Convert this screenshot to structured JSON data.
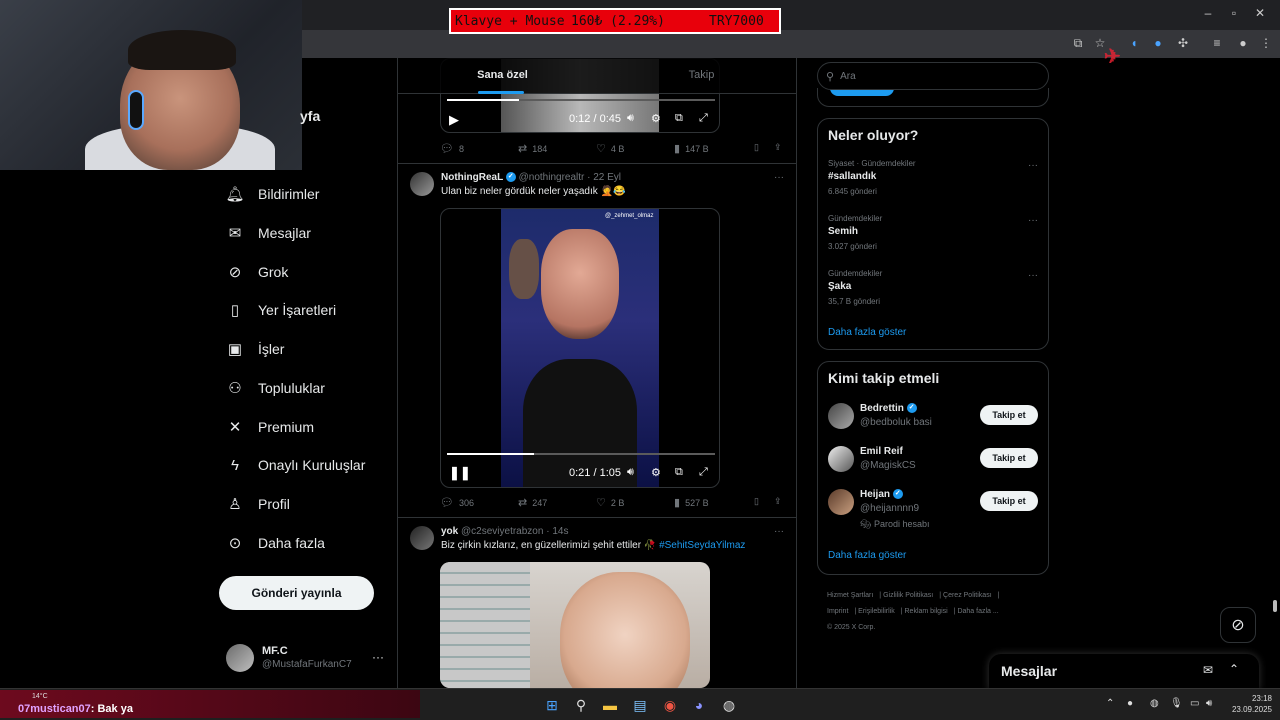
{
  "ticker": {
    "label": "Klavye + Mouse",
    "amount": "160₺ (2.29%)",
    "goal": "TRY7000"
  },
  "nav": {
    "home_fragment": "yfa",
    "items": [
      {
        "label": "Bildirimler",
        "icon": "bell-icon"
      },
      {
        "label": "Mesajlar",
        "icon": "envelope-icon"
      },
      {
        "label": "Grok",
        "icon": "grok-icon"
      },
      {
        "label": "Yer İşaretleri",
        "icon": "bookmark-icon"
      },
      {
        "label": "İşler",
        "icon": "briefcase-icon"
      },
      {
        "label": "Topluluklar",
        "icon": "people-icon"
      },
      {
        "label": "Premium",
        "icon": "x-logo-icon"
      },
      {
        "label": "Onaylı Kuruluşlar",
        "icon": "lightning-icon"
      },
      {
        "label": "Profil",
        "icon": "person-icon"
      },
      {
        "label": "Daha fazla",
        "icon": "more-circle-icon"
      }
    ],
    "post_button": "Gönderi yayınla",
    "account": {
      "name": "MF.C",
      "handle": "@MustafaFurkanC7"
    }
  },
  "timeline": {
    "tabs": [
      "Sana özel",
      "Takip"
    ],
    "video1": {
      "time": "0:12 / 0:45",
      "progress": 0.267
    },
    "tweet1_actions": {
      "replies": "8",
      "reposts": "184",
      "likes": "4 B",
      "views": "147 B"
    },
    "tweet2": {
      "name": "NothingReaL",
      "handle": "@nothingrealtr · 22 Eyl",
      "text": "Ulan biz neler gördük neler yaşadık 🤦😂",
      "watermark": "@_zehmet_olmaz",
      "video_time": "0:21 / 1:05",
      "progress": 0.323,
      "actions": {
        "replies": "306",
        "reposts": "247",
        "likes": "2 B",
        "views": "527 B"
      }
    },
    "tweet3": {
      "name": "yok",
      "handle": "@c2seviyetrabzon · 14s",
      "text": "Biz çirkin kızlarız, en güzellerimizi şehit ettiler 🥀",
      "hashtag": "#SehitSeydaYilmaz"
    }
  },
  "right": {
    "search_placeholder": "Ara",
    "trends_title": "Neler oluyor?",
    "trends": [
      {
        "category": "Siyaset · Gündemdekiler",
        "name": "#sallandık",
        "count": "6.845 gönderi"
      },
      {
        "category": "Gündemdekiler",
        "name": "Semih",
        "count": "3.027 gönderi"
      },
      {
        "category": "Gündemdekiler",
        "name": "Şaka",
        "count": "35,7 B gönderi"
      }
    ],
    "show_more": "Daha fazla göster",
    "follow_title": "Kimi takip etmeli",
    "follow": [
      {
        "name": "Bedrettin",
        "handle": "@bedboluk basi",
        "verified": true
      },
      {
        "name": "Emil Reif",
        "handle": "@MagiskCS",
        "verified": false
      },
      {
        "name": "Heijan",
        "handle": "@heijannnn9",
        "verified": true,
        "note": "Parodi hesabı"
      }
    ],
    "follow_button": "Takip et",
    "footer": [
      "Hizmet Şartları",
      "Gizlilik Politikası",
      "Çerez Politikası",
      "Imprint",
      "Erişilebilirlik",
      "Reklam bilgisi",
      "Daha fazla ...",
      "© 2025 X Corp."
    ]
  },
  "messages_drawer": "Mesajlar",
  "chat": {
    "user": "07mustican07",
    "message": ": Bak ya",
    "temperature": "14°C"
  },
  "clock": {
    "time": "23:18",
    "date": "23.09.2025"
  },
  "colors": {
    "accent": "#1d9bf0",
    "background": "#000000",
    "ticker": "#e8000b"
  }
}
